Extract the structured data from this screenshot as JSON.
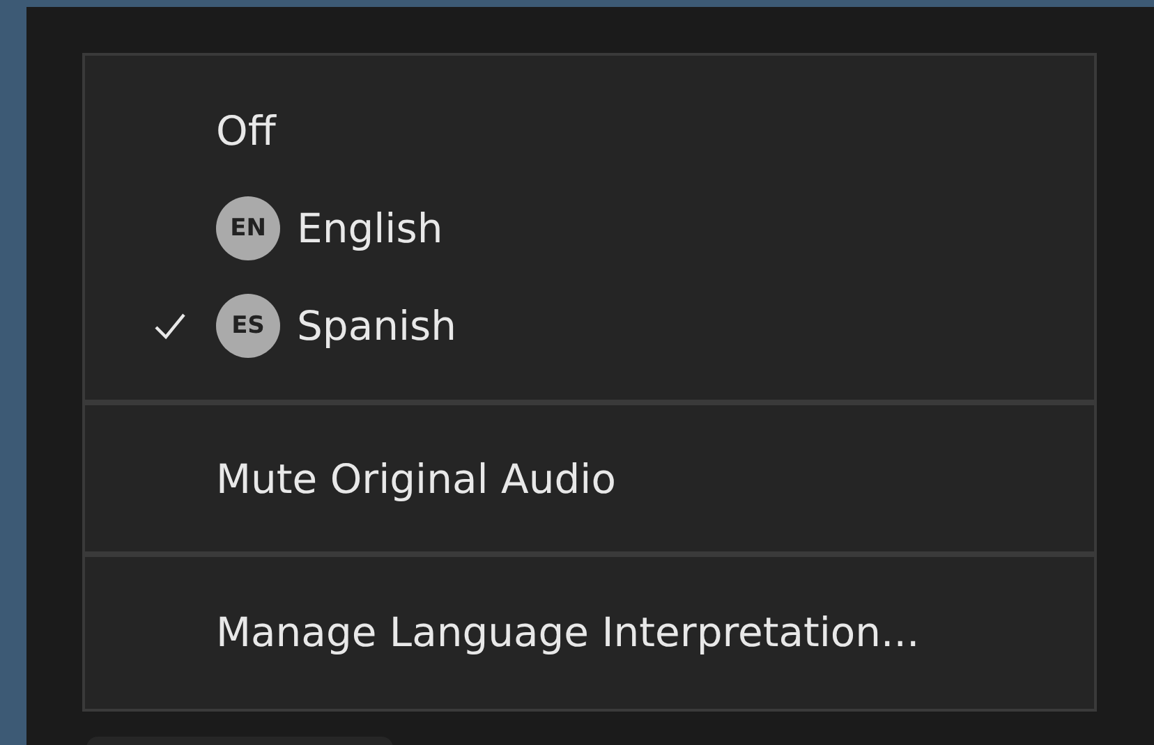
{
  "menu": {
    "sections": [
      {
        "items": [
          {
            "label": "Off",
            "selected": false
          },
          {
            "label": "English",
            "badge": "EN",
            "selected": false
          },
          {
            "label": "Spanish",
            "badge": "ES",
            "selected": true
          }
        ]
      },
      {
        "items": [
          {
            "label": "Mute Original Audio"
          }
        ]
      },
      {
        "items": [
          {
            "label": "Manage Language Interpretation..."
          }
        ]
      }
    ]
  }
}
